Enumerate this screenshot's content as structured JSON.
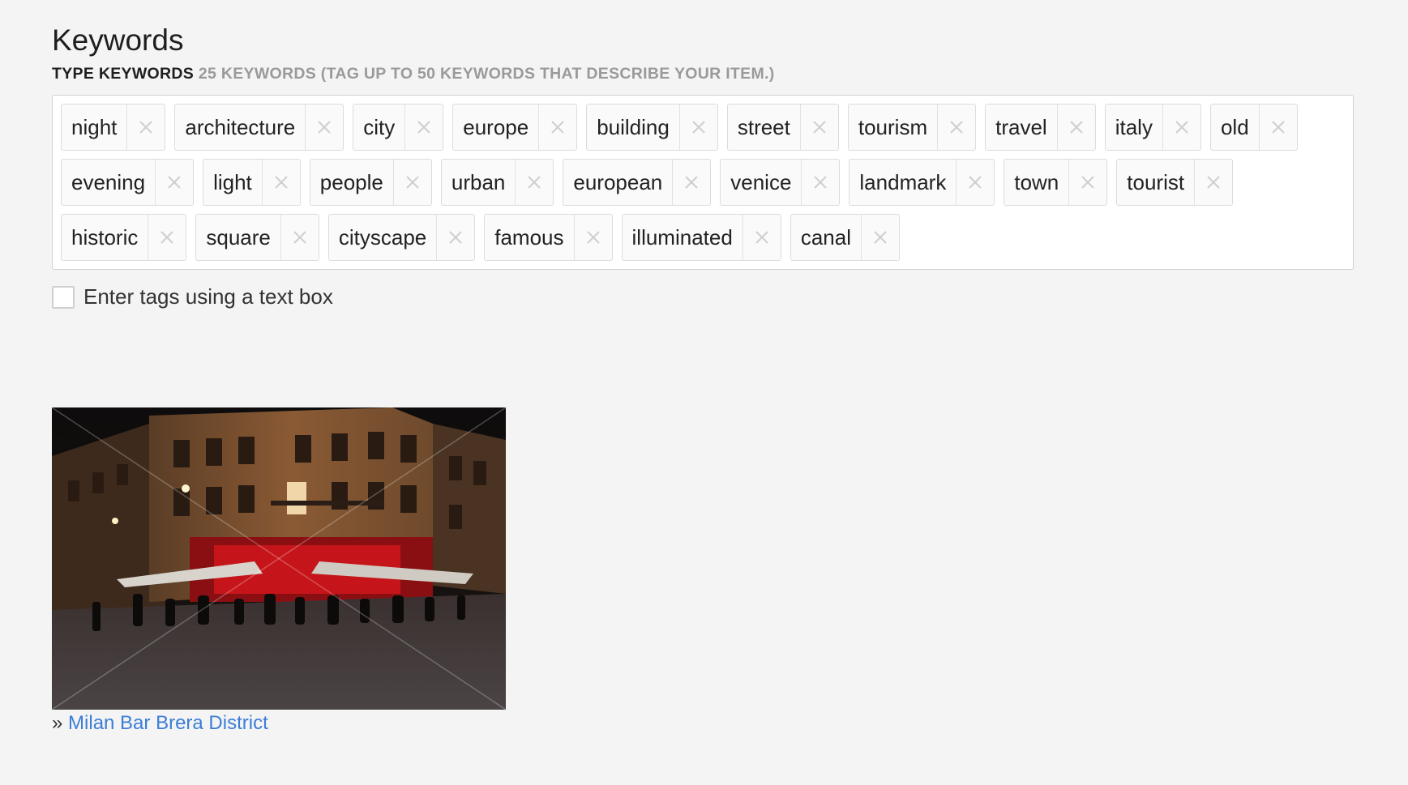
{
  "keywords": {
    "title": "Keywords",
    "subtitle_label": "TYPE KEYWORDS",
    "subtitle_info": "25 KEYWORDS (TAG UP TO 50 KEYWORDS THAT DESCRIBE YOUR ITEM.)",
    "tags": [
      "night",
      "architecture",
      "city",
      "europe",
      "building",
      "street",
      "tourism",
      "travel",
      "italy",
      "old",
      "evening",
      "light",
      "people",
      "urban",
      "european",
      "venice",
      "landmark",
      "town",
      "tourist",
      "historic",
      "square",
      "cityscape",
      "famous",
      "illuminated",
      "canal"
    ],
    "remove_icon": "close-icon",
    "checkbox_label": "Enter tags using a text box",
    "checkbox_checked": false
  },
  "preview": {
    "caption_prefix": "»",
    "caption_link": "Milan Bar Brera District"
  },
  "colors": {
    "link": "#3b7dd8",
    "muted": "#9a9a9a",
    "background": "#f4f4f4"
  }
}
